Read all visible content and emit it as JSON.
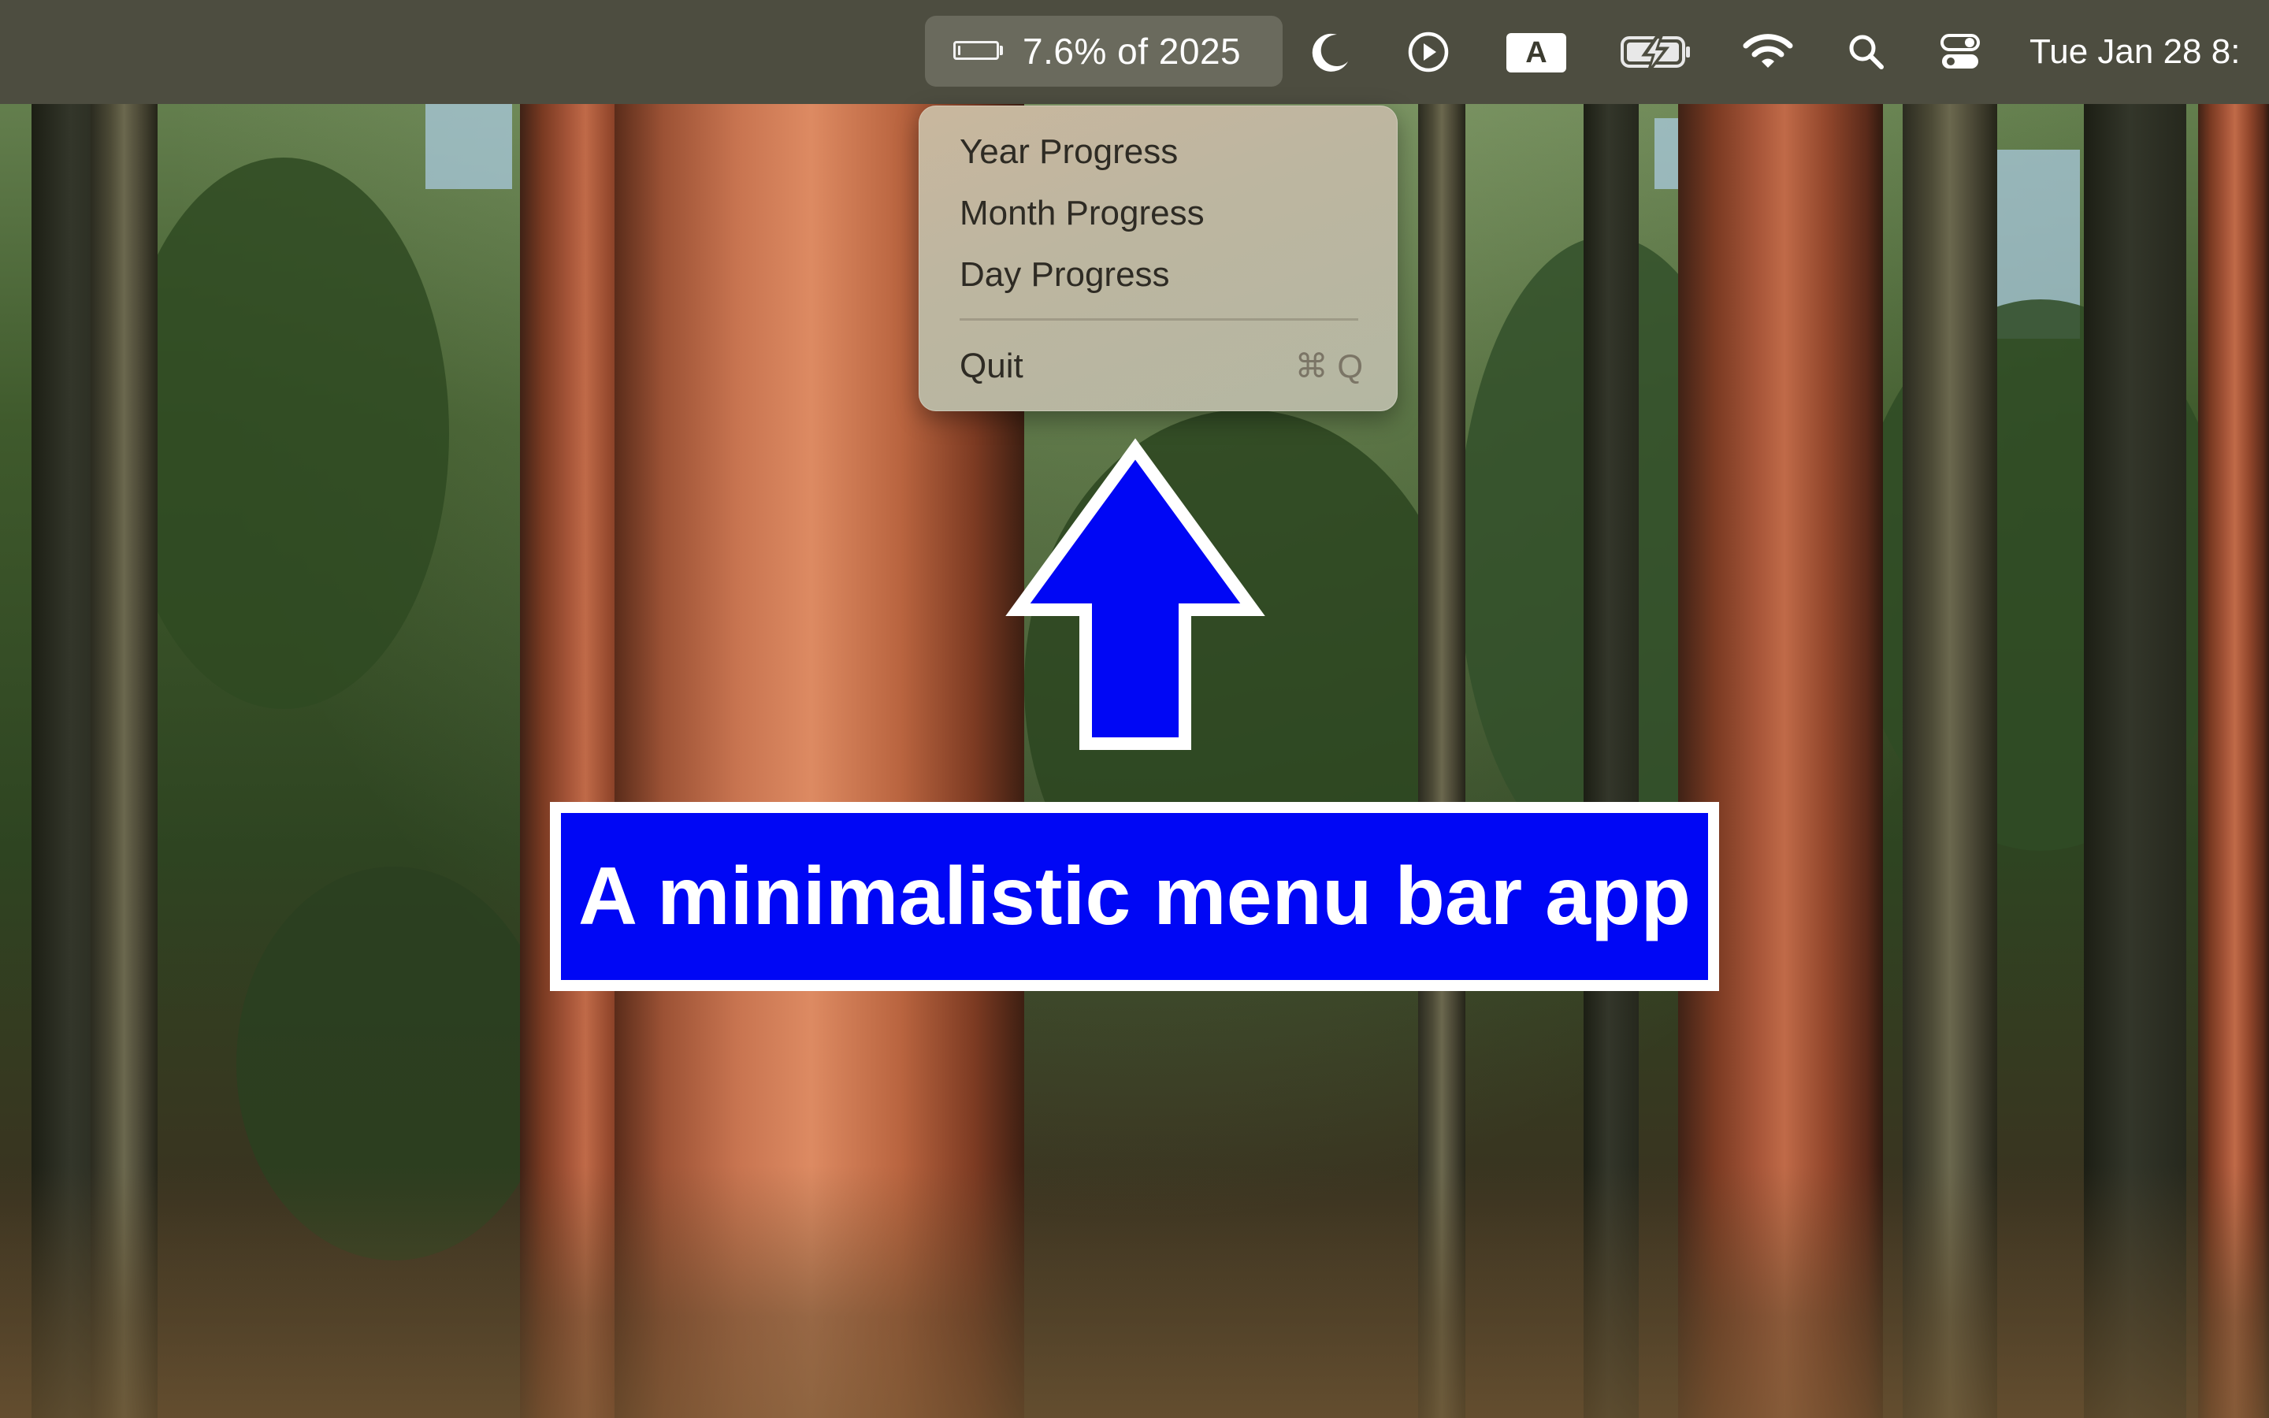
{
  "menubar": {
    "status_item": {
      "text": "7.6% of 2025",
      "progress_fraction": 0.076,
      "icon": "progress-bar-icon"
    },
    "icons": [
      "moon-icon",
      "play-circle-icon",
      "input-source-icon",
      "battery-charging-icon",
      "wifi-icon",
      "search-icon",
      "control-center-icon"
    ],
    "input_source_label": "A",
    "clock": "Tue Jan 28  8:"
  },
  "dropdown": {
    "items": [
      {
        "label": "Year Progress"
      },
      {
        "label": "Month Progress"
      },
      {
        "label": "Day Progress"
      }
    ],
    "quit": {
      "label": "Quit",
      "shortcut": "⌘ Q"
    }
  },
  "annotation": {
    "caption": "A minimalistic menu bar app",
    "arrow_color": "#0007f5",
    "caption_bg": "#0007f5"
  },
  "colors": {
    "menubar_bg": "#4d4d40",
    "status_item_bg": "#6a6a5d",
    "menu_text": "#2e2b24"
  }
}
